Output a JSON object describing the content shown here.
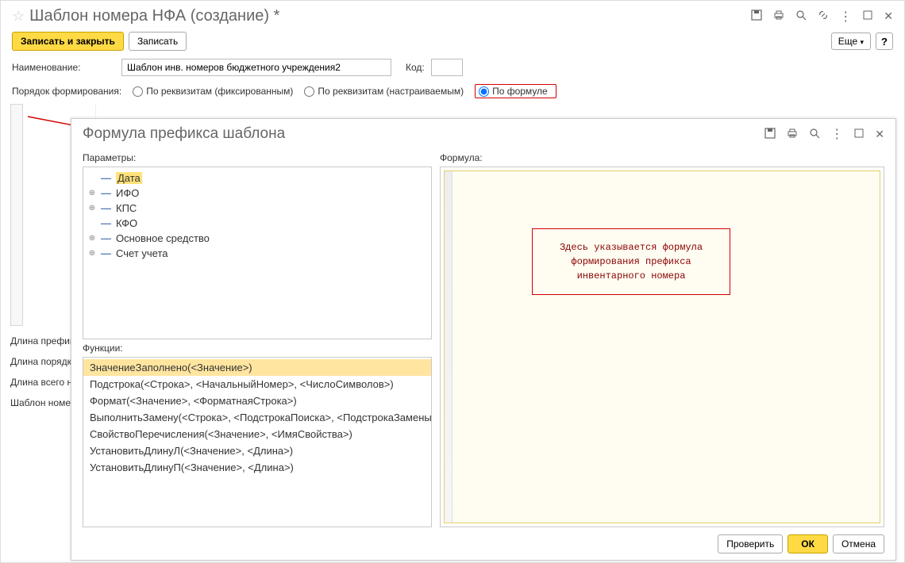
{
  "main": {
    "title": "Шаблон номера НФА (создание) *",
    "save_close": "Записать и закрыть",
    "save": "Записать",
    "more": "Еще",
    "name_label": "Наименование:",
    "name_value": "Шаблон инв. номеров бюджетного учреждения2",
    "code_label": "Код:",
    "code_value": "",
    "order_label": "Порядок формирования:",
    "radio1": "По реквизитам (фиксированным)",
    "radio2": "По реквизитам (настраиваемым)",
    "radio3": "По формуле"
  },
  "back": {
    "r1": "Длина префик",
    "r2": "Длина порядкс",
    "r3": "Длина всего н",
    "r4": "Шаблон номер"
  },
  "modal": {
    "title": "Формула префикса шаблона",
    "params_label": "Параметры:",
    "formula_label": "Формула:",
    "functions_label": "Функции:",
    "callout": "Здесь указывается формула формирования префикса инвентарного номера",
    "check": "Проверить",
    "ok": "ОК",
    "cancel": "Отмена"
  },
  "params": [
    {
      "expand": "",
      "label": "Дата"
    },
    {
      "expand": "+",
      "label": "ИФО"
    },
    {
      "expand": "+",
      "label": "КПС"
    },
    {
      "expand": "",
      "label": "КФО"
    },
    {
      "expand": "+",
      "label": "Основное средство"
    },
    {
      "expand": "+",
      "label": "Счет учета"
    }
  ],
  "functions": [
    "ЗначениеЗаполнено(<Значение>)",
    "Подстрока(<Строка>, <НачальныйНомер>, <ЧислоСимволов>)",
    "Формат(<Значение>, <ФорматнаяСтрока>)",
    "ВыполнитьЗамену(<Строка>, <ПодстрокаПоиска>, <ПодстрокаЗамены>)",
    "СвойствоПеречисления(<Значение>, <ИмяСвойства>)",
    "УстановитьДлинуЛ(<Значение>, <Длина>)",
    "УстановитьДлинуП(<Значение>, <Длина>)"
  ]
}
